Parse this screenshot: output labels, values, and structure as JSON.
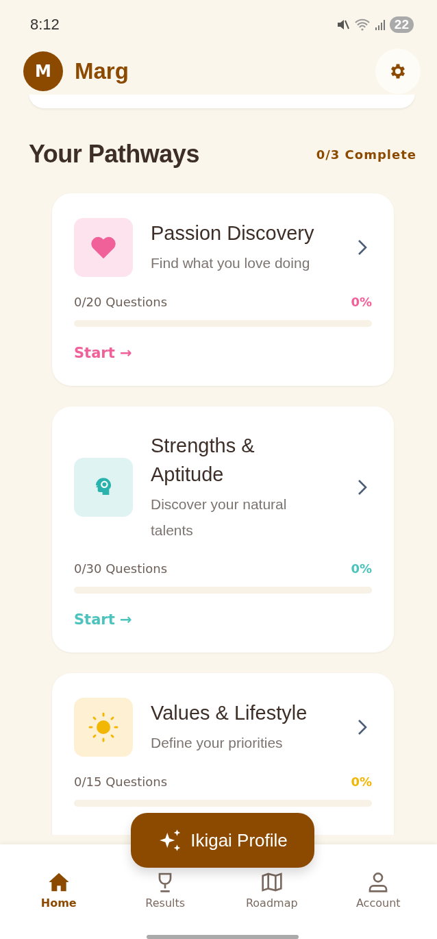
{
  "status_bar": {
    "time": "8:12",
    "battery": "22"
  },
  "header": {
    "avatar_initial": "M",
    "user_name": "Marg"
  },
  "pathways_section": {
    "title": "Your Pathways",
    "progress": "0/3 Complete"
  },
  "pathways": [
    {
      "title": "Passion Discovery",
      "subtitle": "Find what you love doing",
      "questions": "0/20 Questions",
      "percent": "0%",
      "level": 0,
      "color": "#f0619a",
      "action": "Start →"
    },
    {
      "title": "Strengths & Aptitude",
      "subtitle": "Discover your natural talents",
      "questions": "0/30 Questions",
      "percent": "0%",
      "level": 0,
      "color": "#4cc3bd",
      "action": "Start →"
    },
    {
      "title": "Values & Lifestyle",
      "subtitle": "Define your priorities",
      "questions": "0/15 Questions",
      "percent": "0%",
      "level": 0,
      "color": "#f2b705"
    }
  ],
  "floating_button": {
    "label": "Ikigai Profile"
  },
  "bottom_nav": [
    {
      "label": "Home",
      "selected": true
    },
    {
      "label": "Results",
      "selected": false
    },
    {
      "label": "Roadmap",
      "selected": false
    },
    {
      "label": "Account",
      "selected": false
    }
  ]
}
